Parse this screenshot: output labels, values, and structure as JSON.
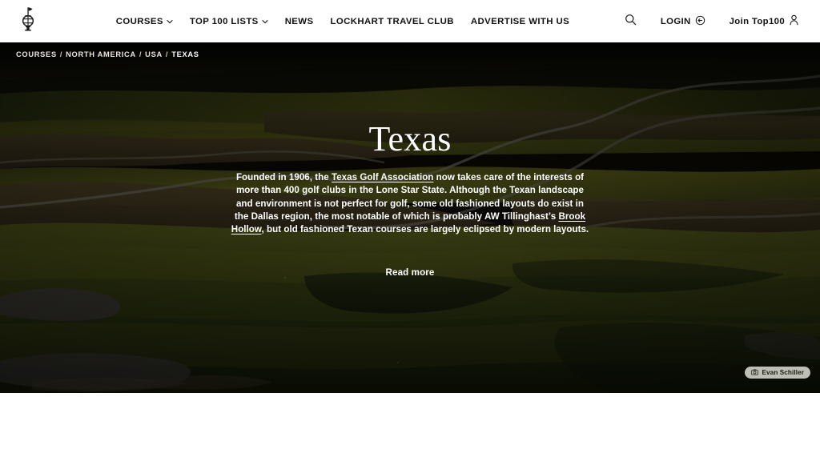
{
  "header": {
    "logo_icon": "golf-lantern-logo-icon",
    "nav": [
      {
        "label": "COURSES",
        "has_dropdown": true,
        "icon": "chevron-down-icon"
      },
      {
        "label": "TOP 100 LISTS",
        "has_dropdown": true,
        "icon": "chevron-down-icon"
      },
      {
        "label": "NEWS",
        "has_dropdown": false
      },
      {
        "label": "LOCKHART TRAVEL CLUB",
        "has_dropdown": false
      },
      {
        "label": "ADVERTISE WITH US",
        "has_dropdown": false
      }
    ],
    "search_icon": "search-icon",
    "login_label": "LOGIN",
    "login_icon": "login-arrow-icon",
    "join_label": "Join Top100",
    "join_icon": "user-icon",
    "background": "#ffffff",
    "text_color": "#111111"
  },
  "breadcrumb": {
    "items": [
      "COURSES",
      "NORTH AMERICA",
      "USA",
      "TEXAS"
    ],
    "separator": "/"
  },
  "hero": {
    "title": "Texas",
    "description_parts": [
      {
        "text": "Founded in 1906, the ",
        "link": false
      },
      {
        "text": "Texas Golf Association",
        "link": true
      },
      {
        "text": " now takes care of the interests of more than 400 golf clubs in the Lone Star State. Although the Texan landscape and environment is not perfect for golf, some old fashioned layouts do exist in the Dallas region, the most notable of which is probably AW Tillinghast’s ",
        "link": false
      },
      {
        "text": "Brook Hollow",
        "link": true
      },
      {
        "text": ", but old fashioned Texan courses are largely eclipsed by modern layouts.",
        "link": false
      }
    ],
    "read_more_label": "Read more",
    "photo_credit": "Evan Schiller",
    "photo_credit_icon": "camera-icon",
    "image_subject": "golf-course-landscape"
  },
  "colors": {
    "hero_fairway_light": "#8e9127",
    "hero_fairway_dark": "#2c3412",
    "hero_rough": "#6b5a33",
    "hero_bunker": "#6e6a63",
    "page_background": "#ffffff",
    "text_light": "#ffffff"
  }
}
